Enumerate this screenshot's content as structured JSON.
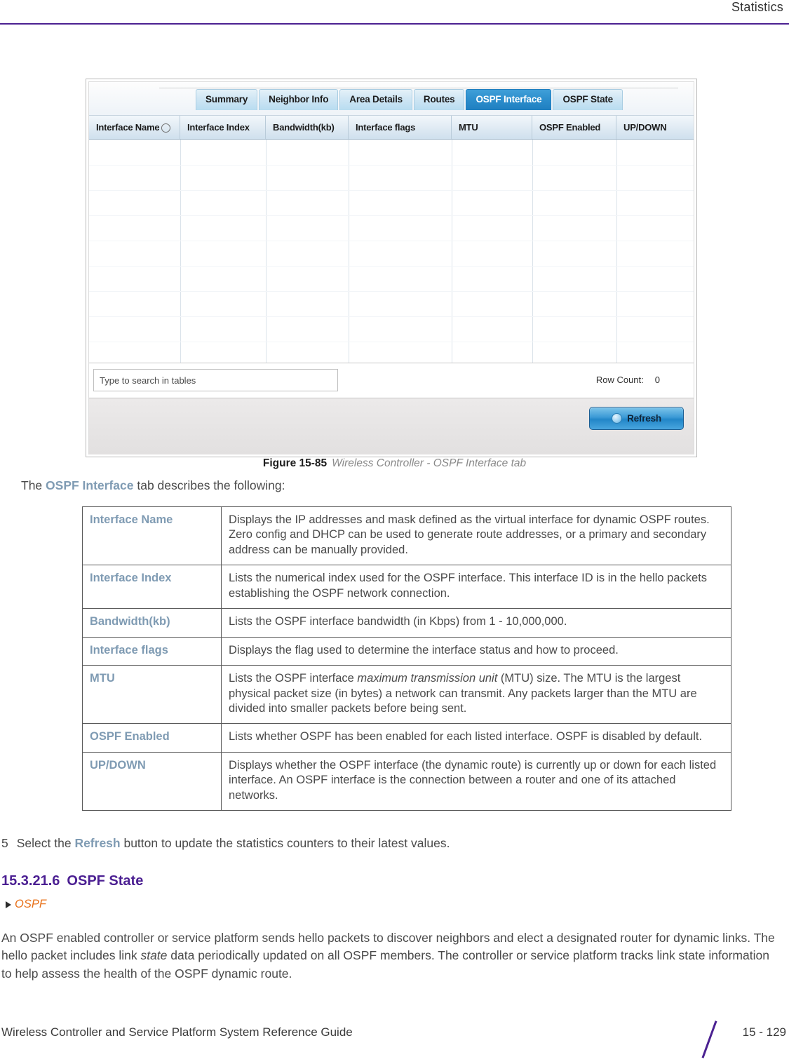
{
  "header": {
    "title": "Statistics"
  },
  "screenshot": {
    "tabs": [
      {
        "label": "Summary",
        "selected": false
      },
      {
        "label": "Neighbor Info",
        "selected": false
      },
      {
        "label": "Area Details",
        "selected": false
      },
      {
        "label": "Routes",
        "selected": false
      },
      {
        "label": "OSPF Interface",
        "selected": true
      },
      {
        "label": "OSPF State",
        "selected": false
      }
    ],
    "columns": [
      "Interface Name",
      "Interface Index",
      "Bandwidth(kb)",
      "Interface flags",
      "MTU",
      "OSPF Enabled",
      "UP/DOWN"
    ],
    "rows": [],
    "search": {
      "value": "",
      "placeholder": "Type to search in tables"
    },
    "row_count_label": "Row Count:",
    "row_count_value": "0",
    "refresh_label": "Refresh",
    "accent_selected_tab": "#2286c8",
    "accent_button": "#2286c8"
  },
  "figure": {
    "number": "Figure 15-85",
    "caption": "Wireless Controller - OSPF Interface tab"
  },
  "intro": {
    "before": "The ",
    "keyword": "OSPF Interface",
    "after": " tab describes the following:"
  },
  "description_table": [
    {
      "label": "Interface Name",
      "text": "Displays the IP addresses and mask defined as the virtual interface for dynamic OSPF routes. Zero config and DHCP can be used to generate route addresses, or a primary and secondary address can be manually provided."
    },
    {
      "label": "Interface Index",
      "text": "Lists the numerical index used for the OSPF interface. This interface ID is in the hello packets establishing the OSPF network connection."
    },
    {
      "label": "Bandwidth(kb)",
      "text": "Lists the OSPF interface bandwidth (in Kbps) from 1 - 10,000,000."
    },
    {
      "label": "Interface flags",
      "text": "Displays the flag used to determine the interface status and how to proceed."
    },
    {
      "label": "MTU",
      "text_before_italic": "Lists the OSPF interface ",
      "italic": "maximum transmission unit",
      "text_after_italic": " (MTU) size. The MTU is the largest physical packet size (in bytes) a network can transmit. Any packets larger than the MTU are divided into smaller packets before being sent."
    },
    {
      "label": "OSPF Enabled",
      "text": "Lists whether OSPF has been enabled for each listed interface. OSPF is disabled by default."
    },
    {
      "label": "UP/DOWN",
      "text": "Displays whether the OSPF interface (the dynamic route) is currently up or down for each listed interface. An OSPF interface is the connection between a router and one of its attached networks."
    }
  ],
  "step": {
    "number": "5",
    "before": "Select the ",
    "keyword": "Refresh",
    "after": " button to update the statistics counters to their latest values."
  },
  "section": {
    "number": "15.3.21.6",
    "title": "OSPF State"
  },
  "breadcrumb": {
    "label": "OSPF"
  },
  "body_paragraph": {
    "before_italic": "An OSPF enabled controller or service platform sends hello packets to discover neighbors and elect a designated router for dynamic links. The hello packet includes link ",
    "italic": "state",
    "after_italic": " data periodically updated on all OSPF members. The controller or service platform tracks link state information to help assess the health of the OSPF dynamic route."
  },
  "footer": {
    "guide_title": "Wireless Controller and Service Platform System Reference Guide",
    "page_number": "15 - 129"
  }
}
